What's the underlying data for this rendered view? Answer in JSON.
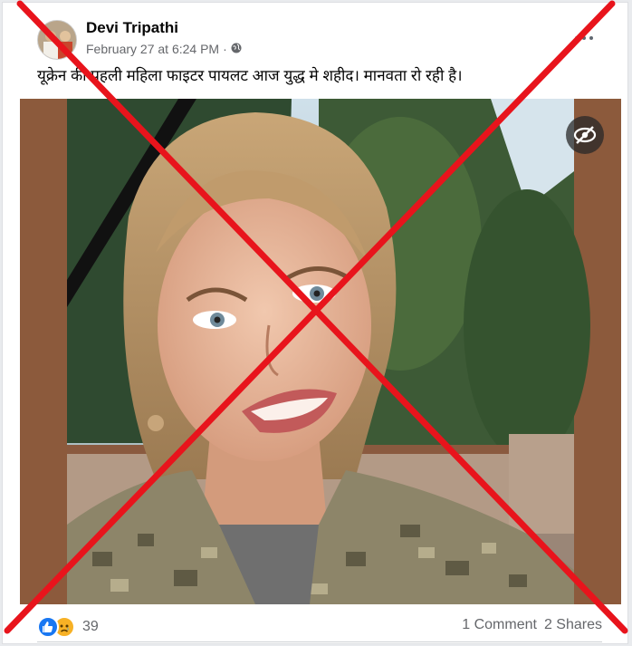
{
  "post": {
    "author": "Devi Tripathi",
    "timestamp": "February 27 at 6:24 PM",
    "privacy_separator": "·",
    "privacy_icon": "globe-icon",
    "caption": "यूक्रेन की पहली महिला फाइटर पायलट आज युद्ध मे शहीद। मानवता रो रही है।"
  },
  "footer": {
    "reaction_icons": [
      "like-icon",
      "sad-icon"
    ],
    "reaction_count": "39",
    "comments": "1 Comment",
    "shares": "2 Shares"
  },
  "colors": {
    "cross": "#e8141c",
    "like": "#1877f2",
    "sad": "#f7b125",
    "photo_border": "#8c5a3c"
  }
}
